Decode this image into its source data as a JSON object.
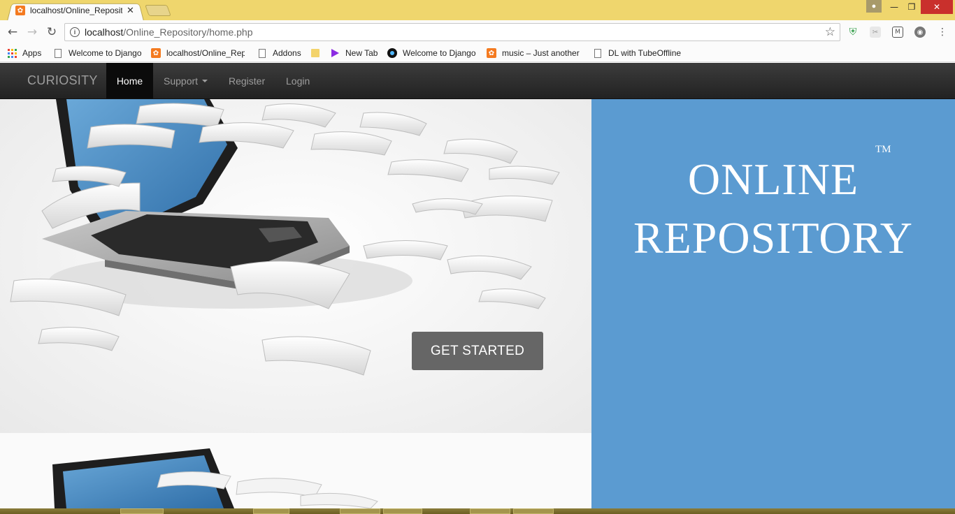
{
  "browser": {
    "tab_title": "localhost/Online_Reposit",
    "tab_close": "✕",
    "url_host": "localhost",
    "url_path": "/Online_Repository/home.php",
    "window_min": "—",
    "window_max": "❐",
    "window_close": "✕",
    "bookmarks": [
      {
        "label": "Apps",
        "icon": "apps-grid-icon"
      },
      {
        "label": "Welcome to Django",
        "icon": "page-icon"
      },
      {
        "label": "localhost/Online_Rep",
        "icon": "xampp-icon"
      },
      {
        "label": "Addons",
        "icon": "page-icon"
      },
      {
        "label": "",
        "icon": "folder-icon"
      },
      {
        "label": "New Tab",
        "icon": "play-icon"
      },
      {
        "label": "Welcome to Django",
        "icon": "circle-icon"
      },
      {
        "label": "music – Just another",
        "icon": "xampp-icon"
      },
      {
        "label": "DL with TubeOffline",
        "icon": "page-icon"
      }
    ]
  },
  "navbar": {
    "brand": "CURIOSITY",
    "items": {
      "home": "Home",
      "support": "Support",
      "register": "Register",
      "login": "Login"
    }
  },
  "hero": {
    "cta": "GET STARTED"
  },
  "logo": {
    "line1": "ONLINE",
    "line2": "REPOSITORY",
    "tm": "TM"
  },
  "colors": {
    "tab_strip": "#efd66d",
    "navbar": "#222222",
    "panel": "#5b9bd1",
    "cta": "#666666"
  }
}
